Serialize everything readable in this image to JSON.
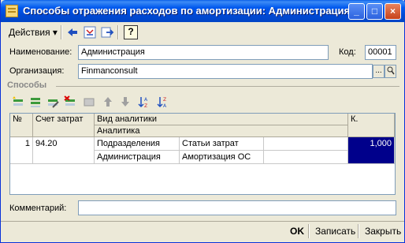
{
  "window": {
    "title": "Способы отражения расходов по амортизации: Администрация",
    "controls": {
      "minimize": "_",
      "maximize": "□",
      "close": "×"
    }
  },
  "menubar": {
    "actions_label": "Действия",
    "icons": [
      "arrow-left-icon",
      "refresh-icon",
      "goto-icon",
      "help-icon"
    ],
    "help_glyph": "?"
  },
  "form": {
    "name_label": "Наименование:",
    "name_value": "Администрация",
    "code_label": "Код:",
    "code_value": "00001",
    "org_label": "Организация:",
    "org_value": "Finmanconsult",
    "select_glyph": "...",
    "search_glyph": "🔍"
  },
  "section_title": "Способы",
  "grid": {
    "headers": {
      "num": "№",
      "account": "Счет затрат",
      "analytics_type": "Вид аналитики",
      "analytics": "Аналитика",
      "coef": "К."
    },
    "rows": [
      {
        "num": "1",
        "account": "94.20",
        "types": [
          "Подразделения",
          "Статьи затрат",
          ""
        ],
        "values": [
          "Администрация",
          "Амортизация ОС",
          ""
        ],
        "coef": "1,000"
      }
    ]
  },
  "comment": {
    "label": "Комментарий:",
    "value": ""
  },
  "buttons": {
    "ok": "OK",
    "save": "Записать",
    "close": "Закрыть"
  },
  "colors": {
    "title_bar": "#0054e3",
    "selected_cell": "#00008b",
    "window_bg": "#ece9d8"
  }
}
